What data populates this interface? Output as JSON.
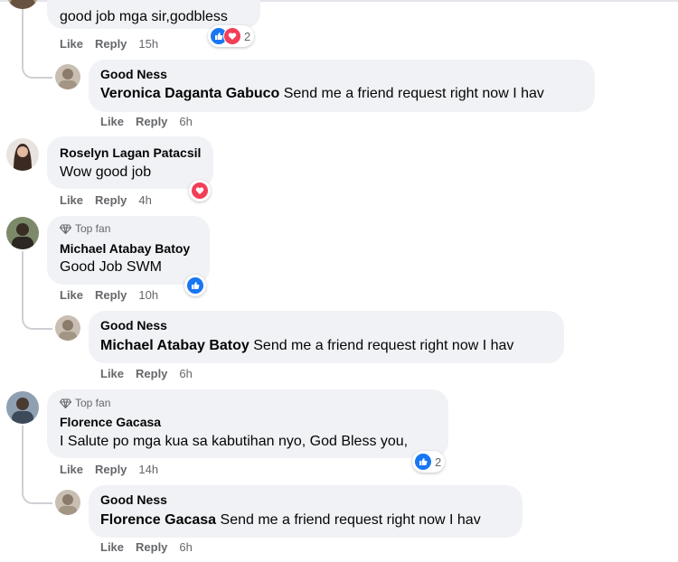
{
  "comments": [
    {
      "text": "good job mga sir,godbless",
      "actions": {
        "like": "Like",
        "reply": "Reply",
        "time": "15h"
      },
      "reactions": {
        "icons": [
          "like-icon",
          "love-icon"
        ],
        "count": "2"
      }
    },
    {
      "author": "Good Ness",
      "mention": "Veronica Daganta Gabuco",
      "text": " Send me a friend request right now I hav",
      "actions": {
        "like": "Like",
        "reply": "Reply",
        "time": "6h"
      }
    },
    {
      "author": "Roselyn Lagan Patacsil",
      "text": "Wow good job",
      "actions": {
        "like": "Like",
        "reply": "Reply",
        "time": "4h"
      },
      "reactions": {
        "icons": [
          "love-icon"
        ]
      }
    },
    {
      "badge": "Top fan",
      "author": "Michael Atabay Batoy",
      "text": "Good Job SWM",
      "actions": {
        "like": "Like",
        "reply": "Reply",
        "time": "10h"
      },
      "reactions": {
        "icons": [
          "like-icon"
        ]
      }
    },
    {
      "author": "Good Ness",
      "mention": "Michael Atabay Batoy",
      "text": " Send me a friend request right now I hav",
      "actions": {
        "like": "Like",
        "reply": "Reply",
        "time": "6h"
      }
    },
    {
      "badge": "Top fan",
      "author": "Florence Gacasa",
      "text": "I Salute po mga kua sa kabutihan nyo, God Bless you,",
      "actions": {
        "like": "Like",
        "reply": "Reply",
        "time": "14h"
      },
      "reactions": {
        "icons": [
          "like-icon"
        ],
        "count": "2"
      }
    },
    {
      "author": "Good Ness",
      "mention": "Florence Gacasa",
      "text": " Send me a friend request right now I hav",
      "actions": {
        "like": "Like",
        "reply": "Reply",
        "time": "6h"
      }
    }
  ],
  "colors": {
    "bubble": "#f0f2f5",
    "secondary_text": "#65676b",
    "like_blue": "#1877f2",
    "love_red": "#f33e58"
  }
}
